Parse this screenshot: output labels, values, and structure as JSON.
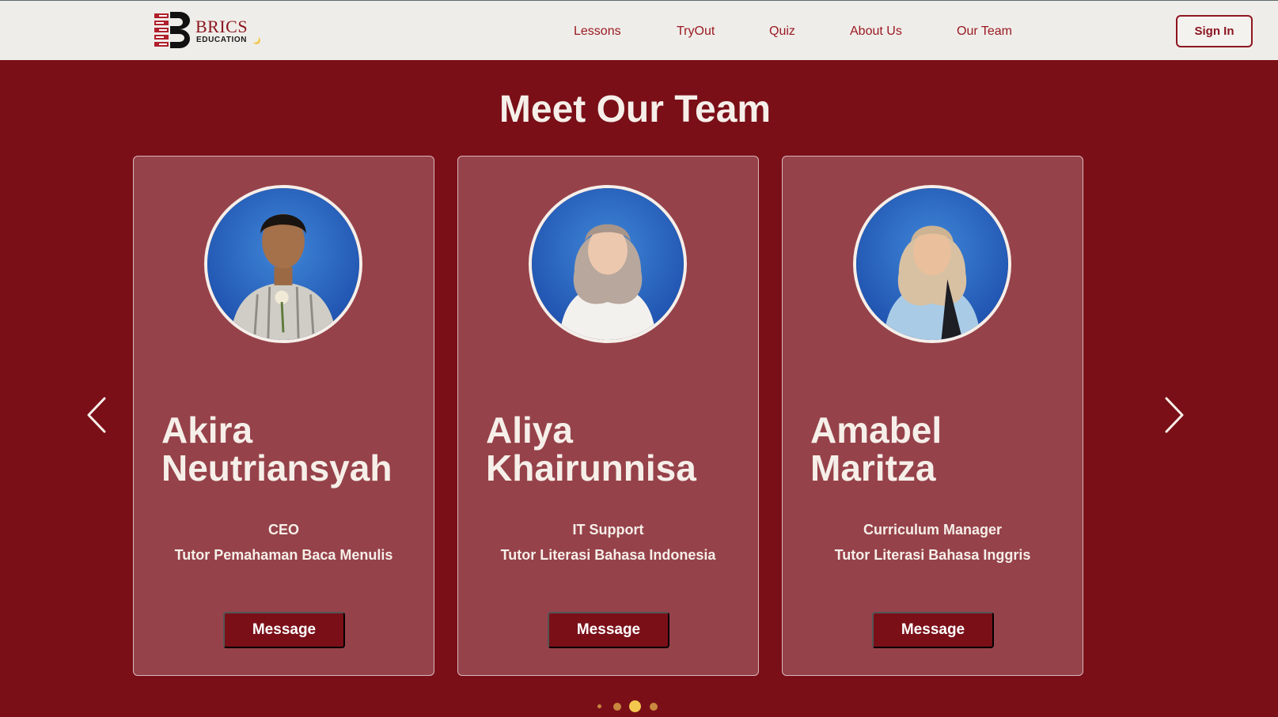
{
  "brand": {
    "name": "BRICS",
    "subtitle": "EDUCATION"
  },
  "nav": {
    "links": [
      {
        "label": "Lessons"
      },
      {
        "label": "TryOut"
      },
      {
        "label": "Quiz"
      },
      {
        "label": "About Us"
      },
      {
        "label": "Our Team"
      }
    ],
    "sign_in_label": "Sign In"
  },
  "section": {
    "title": "Meet Our Team"
  },
  "team": [
    {
      "first_name": "Akira",
      "last_name": "Neutriansyah",
      "role": "CEO",
      "subrole": "Tutor Pemahaman Baca Menulis",
      "button_label": "Message"
    },
    {
      "first_name": "Aliya",
      "last_name": "Khairunnisa",
      "role": "IT Support",
      "subrole": "Tutor Literasi Bahasa Indonesia",
      "button_label": "Message"
    },
    {
      "first_name": "Amabel",
      "last_name": "Maritza",
      "role": "Curriculum Manager",
      "subrole": "Tutor Literasi Bahasa Inggris",
      "button_label": "Message"
    }
  ],
  "carousel": {
    "dot_count": 4,
    "active_dot": 3
  },
  "icons": {
    "prev": "chevron-left-icon",
    "next": "chevron-right-icon",
    "logo": "brics-logo-icon"
  },
  "colors": {
    "page_background": "#7a0f18",
    "card_background": "#96424a",
    "nav_background": "#efede9",
    "brand_red": "#8c1620",
    "dot_active": "#f4c84f",
    "dot_inactive": "#c9873f"
  }
}
